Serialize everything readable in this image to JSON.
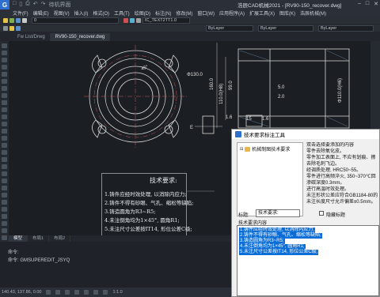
{
  "app": {
    "title": "浩辰CAD机械2021 - [RV90-150_recover.dwg]",
    "logo_text": "G"
  },
  "quick_access": [
    "□",
    "▯",
    "⎙",
    "↶",
    "↷",
    "待机界面"
  ],
  "menu": [
    "文件(F)",
    "编辑(E)",
    "视图(V)",
    "插入(I)",
    "格式(O)",
    "工具(T)",
    "绘图(D)",
    "标注(N)",
    "修改(M)",
    "窗口(W)",
    "应用程序(A)",
    "扩展工具(X)",
    "图库(K)",
    "浩辰机械(M)"
  ],
  "toolbar": {
    "layer_combo": "0",
    "style_combo": "IC_TEXT2TT1.0",
    "color_combo": "ByLayer",
    "linetype_combo": "ByLayer",
    "lineweight_combo": "ByLayer"
  },
  "tabs": [
    {
      "label": "Fw List/Drwg",
      "active": false
    },
    {
      "label": "RV90-150_recover.dwg",
      "active": true
    }
  ],
  "drawing": {
    "dims": {
      "phi": "Φ130.0",
      "h160": "160.0",
      "h110": "110.0(H8)",
      "h99": "99.0",
      "h5": "5.0",
      "h2": "2.0",
      "h110b": "Φ110.0(H6)",
      "h1": "1.6",
      "h15": "15",
      "h17": "1.6",
      "deg": "45°",
      "e": "E"
    },
    "note": {
      "title": "技术要求:",
      "lines": [
        "1.铸件应经时效处理, 以消除内应力;",
        "2.铸件不得有砂眼、气孔、缩松等缺陷;",
        "3.铸造圆角为R3~R5;",
        "4.未注倒角均为1×45°, 圆角R1;",
        "5.未注尺寸公差按IT14, 形位公差C级;"
      ]
    }
  },
  "layout_tabs": [
    {
      "label": "模型",
      "active": true
    },
    {
      "label": "布局1",
      "active": false
    },
    {
      "label": "布局2",
      "active": false
    }
  ],
  "command": {
    "line1": "命令:",
    "line2": "命令: GMSUPEREDIT_JSYQ"
  },
  "status": {
    "coords": "140.43, 137.86, 0.00",
    "scale": "1:1.0"
  },
  "dialog": {
    "title": "技术要求标注工具",
    "tree_item": "机械制图技术要求",
    "explain_lines": [
      "双击选择要添加的内容",
      "零件去除氧化皮。",
      "零件加工表面上, 不应有划痕、擦",
      "去除毛刺飞边。",
      "经调质处理, HRC50~55。",
      "零件进行高频淬火, 350~370℃回",
      "渗碳深度0.3mm。",
      "进行高温时效处理。",
      "未注形状公差应符合GB1184-80的",
      "未注长度尺寸允许偏差±0.5mm。"
    ],
    "title_label": "标题:",
    "title_value": "技术要求:",
    "hide_title_label": "隐藏标题",
    "content_label": "技术要求内容",
    "content_lines": [
      "1.铸件应经时效处理, 以消除内应力;",
      "2.铸件不得有砂眼、气孔、缩松等缺陷;",
      "3.铸造圆角为R3~R5;",
      "4.未注倒角均为1×45°, 圆角R1;",
      "5.未注尺寸公差按IT14, 形位公差C级;"
    ]
  }
}
